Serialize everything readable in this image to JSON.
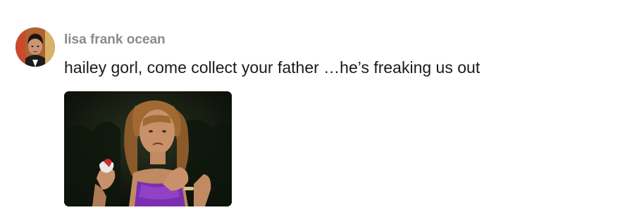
{
  "comment": {
    "author": "lisa frank ocean",
    "text": "hailey gorl, come collect your father …he’s freaking us out",
    "avatar": "user-avatar-icon",
    "media": "reaction-gif-image"
  },
  "colors": {
    "author_text": "#8a8a8a",
    "body_text": "#1a1a1a",
    "gif_background": "#0a120a",
    "dress": "#7a2fb0"
  }
}
